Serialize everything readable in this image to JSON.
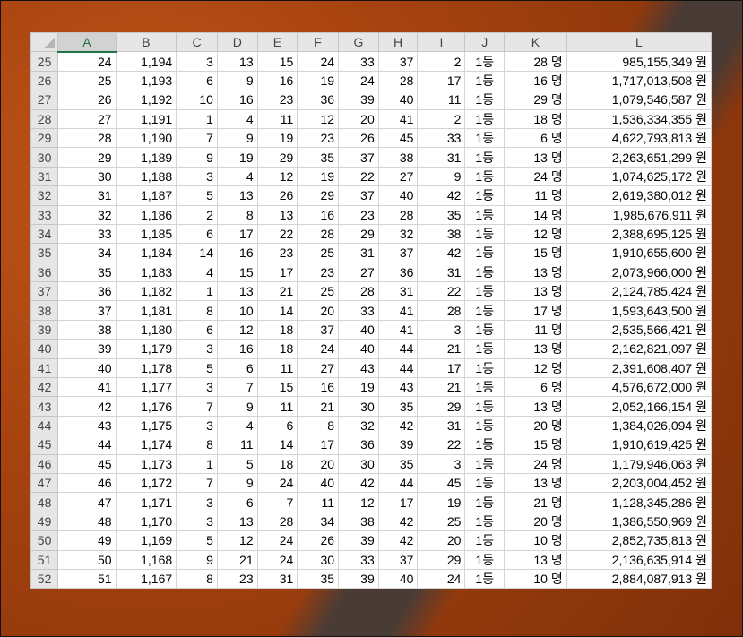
{
  "columns": [
    "A",
    "B",
    "C",
    "D",
    "E",
    "F",
    "G",
    "H",
    "I",
    "J",
    "K",
    "L"
  ],
  "active_column": "A",
  "rows": [
    {
      "row": "25",
      "A": "24",
      "B": "1,194",
      "C": "3",
      "D": "13",
      "E": "15",
      "F": "24",
      "G": "33",
      "H": "37",
      "I": "2",
      "J": "1등",
      "K": "28 명",
      "L": "985,155,349 원"
    },
    {
      "row": "26",
      "A": "25",
      "B": "1,193",
      "C": "6",
      "D": "9",
      "E": "16",
      "F": "19",
      "G": "24",
      "H": "28",
      "I": "17",
      "J": "1등",
      "K": "16 명",
      "L": "1,717,013,508 원"
    },
    {
      "row": "27",
      "A": "26",
      "B": "1,192",
      "C": "10",
      "D": "16",
      "E": "23",
      "F": "36",
      "G": "39",
      "H": "40",
      "I": "11",
      "J": "1등",
      "K": "29 명",
      "L": "1,079,546,587 원"
    },
    {
      "row": "28",
      "A": "27",
      "B": "1,191",
      "C": "1",
      "D": "4",
      "E": "11",
      "F": "12",
      "G": "20",
      "H": "41",
      "I": "2",
      "J": "1등",
      "K": "18 명",
      "L": "1,536,334,355 원"
    },
    {
      "row": "29",
      "A": "28",
      "B": "1,190",
      "C": "7",
      "D": "9",
      "E": "19",
      "F": "23",
      "G": "26",
      "H": "45",
      "I": "33",
      "J": "1등",
      "K": "6 명",
      "L": "4,622,793,813 원"
    },
    {
      "row": "30",
      "A": "29",
      "B": "1,189",
      "C": "9",
      "D": "19",
      "E": "29",
      "F": "35",
      "G": "37",
      "H": "38",
      "I": "31",
      "J": "1등",
      "K": "13 명",
      "L": "2,263,651,299 원"
    },
    {
      "row": "31",
      "A": "30",
      "B": "1,188",
      "C": "3",
      "D": "4",
      "E": "12",
      "F": "19",
      "G": "22",
      "H": "27",
      "I": "9",
      "J": "1등",
      "K": "24 명",
      "L": "1,074,625,172 원"
    },
    {
      "row": "32",
      "A": "31",
      "B": "1,187",
      "C": "5",
      "D": "13",
      "E": "26",
      "F": "29",
      "G": "37",
      "H": "40",
      "I": "42",
      "J": "1등",
      "K": "11 명",
      "L": "2,619,380,012 원"
    },
    {
      "row": "33",
      "A": "32",
      "B": "1,186",
      "C": "2",
      "D": "8",
      "E": "13",
      "F": "16",
      "G": "23",
      "H": "28",
      "I": "35",
      "J": "1등",
      "K": "14 명",
      "L": "1,985,676,911 원"
    },
    {
      "row": "34",
      "A": "33",
      "B": "1,185",
      "C": "6",
      "D": "17",
      "E": "22",
      "F": "28",
      "G": "29",
      "H": "32",
      "I": "38",
      "J": "1등",
      "K": "12 명",
      "L": "2,388,695,125 원"
    },
    {
      "row": "35",
      "A": "34",
      "B": "1,184",
      "C": "14",
      "D": "16",
      "E": "23",
      "F": "25",
      "G": "31",
      "H": "37",
      "I": "42",
      "J": "1등",
      "K": "15 명",
      "L": "1,910,655,600 원"
    },
    {
      "row": "36",
      "A": "35",
      "B": "1,183",
      "C": "4",
      "D": "15",
      "E": "17",
      "F": "23",
      "G": "27",
      "H": "36",
      "I": "31",
      "J": "1등",
      "K": "13 명",
      "L": "2,073,966,000 원"
    },
    {
      "row": "37",
      "A": "36",
      "B": "1,182",
      "C": "1",
      "D": "13",
      "E": "21",
      "F": "25",
      "G": "28",
      "H": "31",
      "I": "22",
      "J": "1등",
      "K": "13 명",
      "L": "2,124,785,424 원"
    },
    {
      "row": "38",
      "A": "37",
      "B": "1,181",
      "C": "8",
      "D": "10",
      "E": "14",
      "F": "20",
      "G": "33",
      "H": "41",
      "I": "28",
      "J": "1등",
      "K": "17 명",
      "L": "1,593,643,500 원"
    },
    {
      "row": "39",
      "A": "38",
      "B": "1,180",
      "C": "6",
      "D": "12",
      "E": "18",
      "F": "37",
      "G": "40",
      "H": "41",
      "I": "3",
      "J": "1등",
      "K": "11 명",
      "L": "2,535,566,421 원"
    },
    {
      "row": "40",
      "A": "39",
      "B": "1,179",
      "C": "3",
      "D": "16",
      "E": "18",
      "F": "24",
      "G": "40",
      "H": "44",
      "I": "21",
      "J": "1등",
      "K": "13 명",
      "L": "2,162,821,097 원"
    },
    {
      "row": "41",
      "A": "40",
      "B": "1,178",
      "C": "5",
      "D": "6",
      "E": "11",
      "F": "27",
      "G": "43",
      "H": "44",
      "I": "17",
      "J": "1등",
      "K": "12 명",
      "L": "2,391,608,407 원"
    },
    {
      "row": "42",
      "A": "41",
      "B": "1,177",
      "C": "3",
      "D": "7",
      "E": "15",
      "F": "16",
      "G": "19",
      "H": "43",
      "I": "21",
      "J": "1등",
      "K": "6 명",
      "L": "4,576,672,000 원"
    },
    {
      "row": "43",
      "A": "42",
      "B": "1,176",
      "C": "7",
      "D": "9",
      "E": "11",
      "F": "21",
      "G": "30",
      "H": "35",
      "I": "29",
      "J": "1등",
      "K": "13 명",
      "L": "2,052,166,154 원"
    },
    {
      "row": "44",
      "A": "43",
      "B": "1,175",
      "C": "3",
      "D": "4",
      "E": "6",
      "F": "8",
      "G": "32",
      "H": "42",
      "I": "31",
      "J": "1등",
      "K": "20 명",
      "L": "1,384,026,094 원"
    },
    {
      "row": "45",
      "A": "44",
      "B": "1,174",
      "C": "8",
      "D": "11",
      "E": "14",
      "F": "17",
      "G": "36",
      "H": "39",
      "I": "22",
      "J": "1등",
      "K": "15 명",
      "L": "1,910,619,425 원"
    },
    {
      "row": "46",
      "A": "45",
      "B": "1,173",
      "C": "1",
      "D": "5",
      "E": "18",
      "F": "20",
      "G": "30",
      "H": "35",
      "I": "3",
      "J": "1등",
      "K": "24 명",
      "L": "1,179,946,063 원"
    },
    {
      "row": "47",
      "A": "46",
      "B": "1,172",
      "C": "7",
      "D": "9",
      "E": "24",
      "F": "40",
      "G": "42",
      "H": "44",
      "I": "45",
      "J": "1등",
      "K": "13 명",
      "L": "2,203,004,452 원"
    },
    {
      "row": "48",
      "A": "47",
      "B": "1,171",
      "C": "3",
      "D": "6",
      "E": "7",
      "F": "11",
      "G": "12",
      "H": "17",
      "I": "19",
      "J": "1등",
      "K": "21 명",
      "L": "1,128,345,286 원"
    },
    {
      "row": "49",
      "A": "48",
      "B": "1,170",
      "C": "3",
      "D": "13",
      "E": "28",
      "F": "34",
      "G": "38",
      "H": "42",
      "I": "25",
      "J": "1등",
      "K": "20 명",
      "L": "1,386,550,969 원"
    },
    {
      "row": "50",
      "A": "49",
      "B": "1,169",
      "C": "5",
      "D": "12",
      "E": "24",
      "F": "26",
      "G": "39",
      "H": "42",
      "I": "20",
      "J": "1등",
      "K": "10 명",
      "L": "2,852,735,813 원"
    },
    {
      "row": "51",
      "A": "50",
      "B": "1,168",
      "C": "9",
      "D": "21",
      "E": "24",
      "F": "30",
      "G": "33",
      "H": "37",
      "I": "29",
      "J": "1등",
      "K": "13 명",
      "L": "2,136,635,914 원"
    },
    {
      "row": "52",
      "A": "51",
      "B": "1,167",
      "C": "8",
      "D": "23",
      "E": "31",
      "F": "35",
      "G": "39",
      "H": "40",
      "I": "24",
      "J": "1등",
      "K": "10 명",
      "L": "2,884,087,913 원"
    }
  ]
}
